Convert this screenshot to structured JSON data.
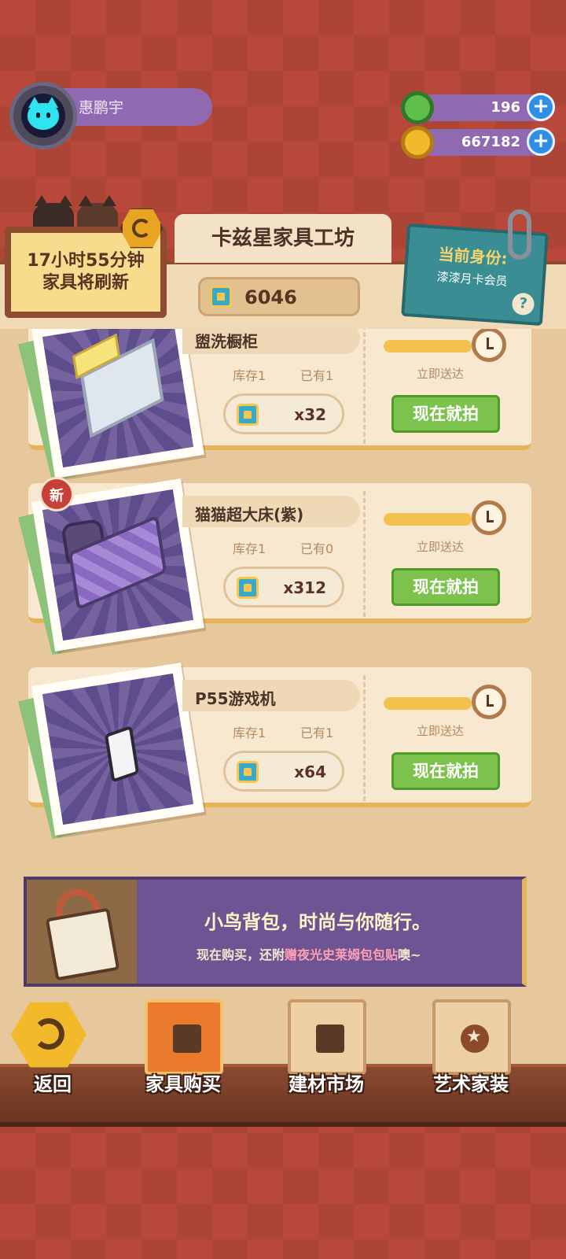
{
  "profile": {
    "name": "惠鹏宇",
    "avatar_icon": "cat-avatar-icon"
  },
  "currencies": [
    {
      "icon": "green-donut-coin-icon",
      "amount": "196",
      "color": "#5fbf4a"
    },
    {
      "icon": "gold-planet-coin-icon",
      "amount": "667182",
      "color": "#f2b92a"
    }
  ],
  "shop": {
    "refresh_line1": "17小时55分钟",
    "refresh_line2": "家具将刷新",
    "title": "卡兹星家具工坊",
    "token_balance": "6046",
    "member_label": "当前身份:",
    "member_value": "漆漆月卡会员",
    "help": "?"
  },
  "items": [
    {
      "name": "盥洗橱柜",
      "stock_label": "库存1",
      "owned_label": "已有1",
      "price": "x32",
      "deliver_label": "立即送达",
      "buy_label": "现在就拍",
      "is_new": false,
      "progress": 0.8
    },
    {
      "name": "猫猫超大床(紫)",
      "stock_label": "库存1",
      "owned_label": "已有0",
      "price": "x312",
      "deliver_label": "立即送达",
      "buy_label": "现在就拍",
      "is_new": true,
      "new_badge": "新",
      "progress": 0.8
    },
    {
      "name": "P55游戏机",
      "stock_label": "库存1",
      "owned_label": "已有1",
      "price": "x64",
      "deliver_label": "立即送达",
      "buy_label": "现在就拍",
      "is_new": false,
      "progress": 0.8
    }
  ],
  "banner": {
    "title": "小鸟背包，时尚与你随行。",
    "sub_prefix": "现在购买，还附",
    "sub_highlight": "赠夜光史莱姆包包贴",
    "sub_suffix": "噢~"
  },
  "nav": {
    "back": "返回",
    "furniture": "家具购买",
    "materials": "建材市场",
    "art": "艺术家装"
  }
}
